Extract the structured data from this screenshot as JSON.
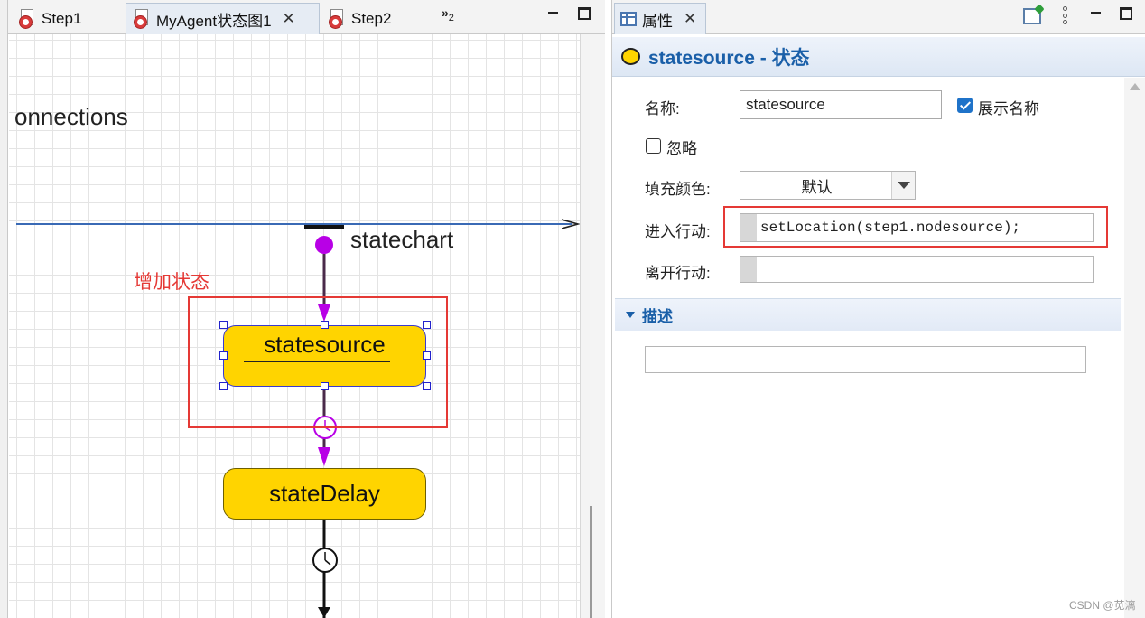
{
  "editor": {
    "tabs": [
      {
        "label": "Step1"
      },
      {
        "label": "MyAgent状态图1"
      },
      {
        "label": "Step2"
      }
    ],
    "overflow_label": "»",
    "overflow_count": "2",
    "canvas": {
      "connections_label": "onnections",
      "statechart_label": "statechart",
      "note": "增加状态",
      "states": {
        "source": "statesource",
        "delay": "stateDelay"
      }
    }
  },
  "properties": {
    "tab_label": "属性",
    "title": "statesource - 状态",
    "fields": {
      "name_label": "名称:",
      "name_value": "statesource",
      "show_name_label": "展示名称",
      "show_name_checked": true,
      "ignore_label": "忽略",
      "ignore_checked": false,
      "fill_color_label": "填充颜色:",
      "fill_color_value": "默认",
      "enter_action_label": "进入行动:",
      "enter_action_value": "setLocation(step1.nodesource);",
      "exit_action_label": "离开行动:",
      "exit_action_value": ""
    },
    "description_section": "描述",
    "description_value": ""
  },
  "colors": {
    "state_fill": "#ffd400",
    "highlight_red": "#e53935",
    "transition_purple": "#b800e6",
    "title_blue": "#1a5fa8"
  },
  "watermark": "CSDN @苋漓"
}
